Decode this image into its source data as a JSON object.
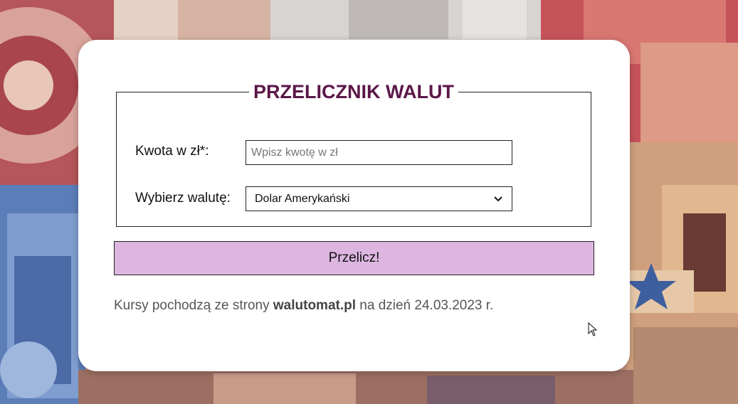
{
  "form": {
    "legend": "PRZELICZNIK WALUT",
    "amount_label": "Kwota w zł*:",
    "amount_value": "",
    "amount_placeholder": "Wpisz kwotę w zł",
    "currency_label": "Wybierz walutę:",
    "currency_selected": "Dolar Amerykański",
    "submit_label": "Przelicz!"
  },
  "footnote": {
    "prefix": "Kursy pochodzą ze strony ",
    "source": "walutomat.pl",
    "suffix": " na dzień 24.03.2023 r."
  },
  "colors": {
    "legend": "#5b1748",
    "button_bg": "#dcb6e0",
    "card_bg": "#ffffff"
  },
  "icons": {
    "select_arrow": "chevron-down-icon",
    "cursor": "mouse-pointer-icon",
    "background": "euro-banknotes-photo"
  }
}
